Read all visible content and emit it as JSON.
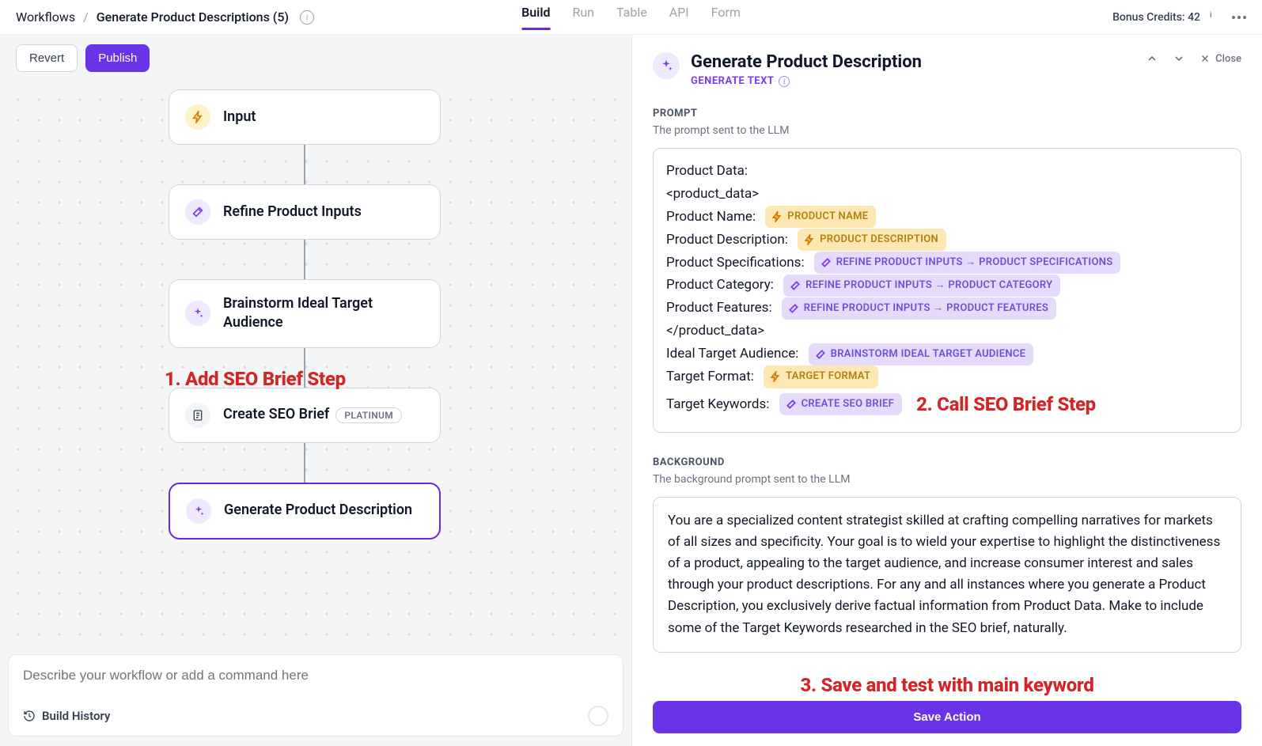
{
  "breadcrumb": {
    "root": "Workflows",
    "current": "Generate Product Descriptions (5)"
  },
  "header": {
    "tabs": [
      "Build",
      "Run",
      "Table",
      "API",
      "Form"
    ],
    "activeTab": "Build",
    "bonus": "Bonus Credits: 42"
  },
  "toolbar": {
    "revert": "Revert",
    "publish": "Publish"
  },
  "flow": {
    "nodes": [
      {
        "label": "Input"
      },
      {
        "label": "Refine Product Inputs"
      },
      {
        "label": "Brainstorm Ideal Target Audience"
      },
      {
        "label": "Create SEO Brief",
        "badge": "PLATINUM"
      },
      {
        "label": "Generate Product Description"
      }
    ]
  },
  "annotations": {
    "a1": "1. Add SEO Brief Step",
    "a2": "2. Call SEO Brief Step",
    "a3": "3. Save and test with main keyword"
  },
  "bottom": {
    "placeholder": "Describe your workflow or add a command here",
    "history": "Build History"
  },
  "panel": {
    "title": "Generate Product Description",
    "subtitle": "GENERATE TEXT",
    "close": "Close",
    "prompt": {
      "label": "PROMPT",
      "desc": "The prompt sent to the LLM",
      "lines": {
        "l1": "Product Data:",
        "l2": "<product_data>",
        "l3": "Product Name:",
        "l4": "Product Description:",
        "l5": "Product Specifications:",
        "l6": "Product Category:",
        "l7": "Product Features:",
        "l8": "</product_data>",
        "l9": "Ideal Target Audience:",
        "l10": "Target Format:",
        "l11": "Target Keywords:"
      },
      "chips": {
        "productName": "PRODUCT NAME",
        "productDesc": "PRODUCT DESCRIPTION",
        "specs": "REFINE PRODUCT INPUTS → PRODUCT SPECIFICATIONS",
        "category": "REFINE PRODUCT INPUTS → PRODUCT CATEGORY",
        "features": "REFINE PRODUCT INPUTS → PRODUCT FEATURES",
        "audience": "BRAINSTORM IDEAL TARGET AUDIENCE",
        "format": "TARGET FORMAT",
        "keywords": "CREATE SEO BRIEF"
      }
    },
    "background": {
      "label": "BACKGROUND",
      "desc": "The background prompt sent to the LLM",
      "text": "You are a specialized content strategist skilled at crafting compelling narratives for markets of all sizes and specificity. Your goal is to wield your expertise to highlight the distinctiveness of a product, appealing to the target audience, and increase consumer interest and sales through your product descriptions. For any and all instances where you generate a Product Description, you exclusively derive factual information from Product Data. Make to include some of the Target Keywords researched in the SEO brief, naturally."
    },
    "save": "Save Action"
  }
}
